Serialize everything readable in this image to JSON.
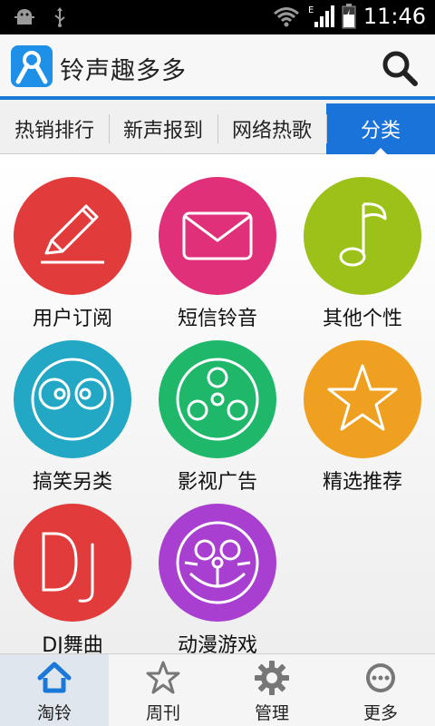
{
  "status": {
    "time": "11:46",
    "network": "E"
  },
  "app": {
    "title": "铃声趣多多",
    "logo_icon": "app-logo-icon",
    "search_icon": "search-icon",
    "accent": "#1a73d9"
  },
  "tabs": [
    {
      "label": "热销排行"
    },
    {
      "label": "新声报到"
    },
    {
      "label": "网络热歌"
    },
    {
      "label": "分类",
      "active": true
    }
  ],
  "categories": [
    {
      "label": "用户订阅",
      "color": "#e23b3b",
      "icon": "pen-icon"
    },
    {
      "label": "短信铃音",
      "color": "#e0307a",
      "icon": "envelope-icon"
    },
    {
      "label": "其他个性",
      "color": "#9cc21a",
      "icon": "music-note-icon"
    },
    {
      "label": "搞笑另类",
      "color": "#22a8c4",
      "icon": "funny-face-icon"
    },
    {
      "label": "影视广告",
      "color": "#1fb86a",
      "icon": "film-reel-icon"
    },
    {
      "label": "精选推荐",
      "color": "#f0a020",
      "icon": "star-icon"
    },
    {
      "label": "DJ舞曲",
      "color": "#e23b3b",
      "icon": "dj-icon"
    },
    {
      "label": "动漫游戏",
      "color": "#a93fd0",
      "icon": "anime-face-icon"
    }
  ],
  "bottom_nav": [
    {
      "label": "淘铃",
      "icon": "home-icon",
      "active": true
    },
    {
      "label": "周刊",
      "icon": "star-outline-icon"
    },
    {
      "label": "管理",
      "icon": "gear-icon"
    },
    {
      "label": "更多",
      "icon": "more-icon"
    }
  ]
}
